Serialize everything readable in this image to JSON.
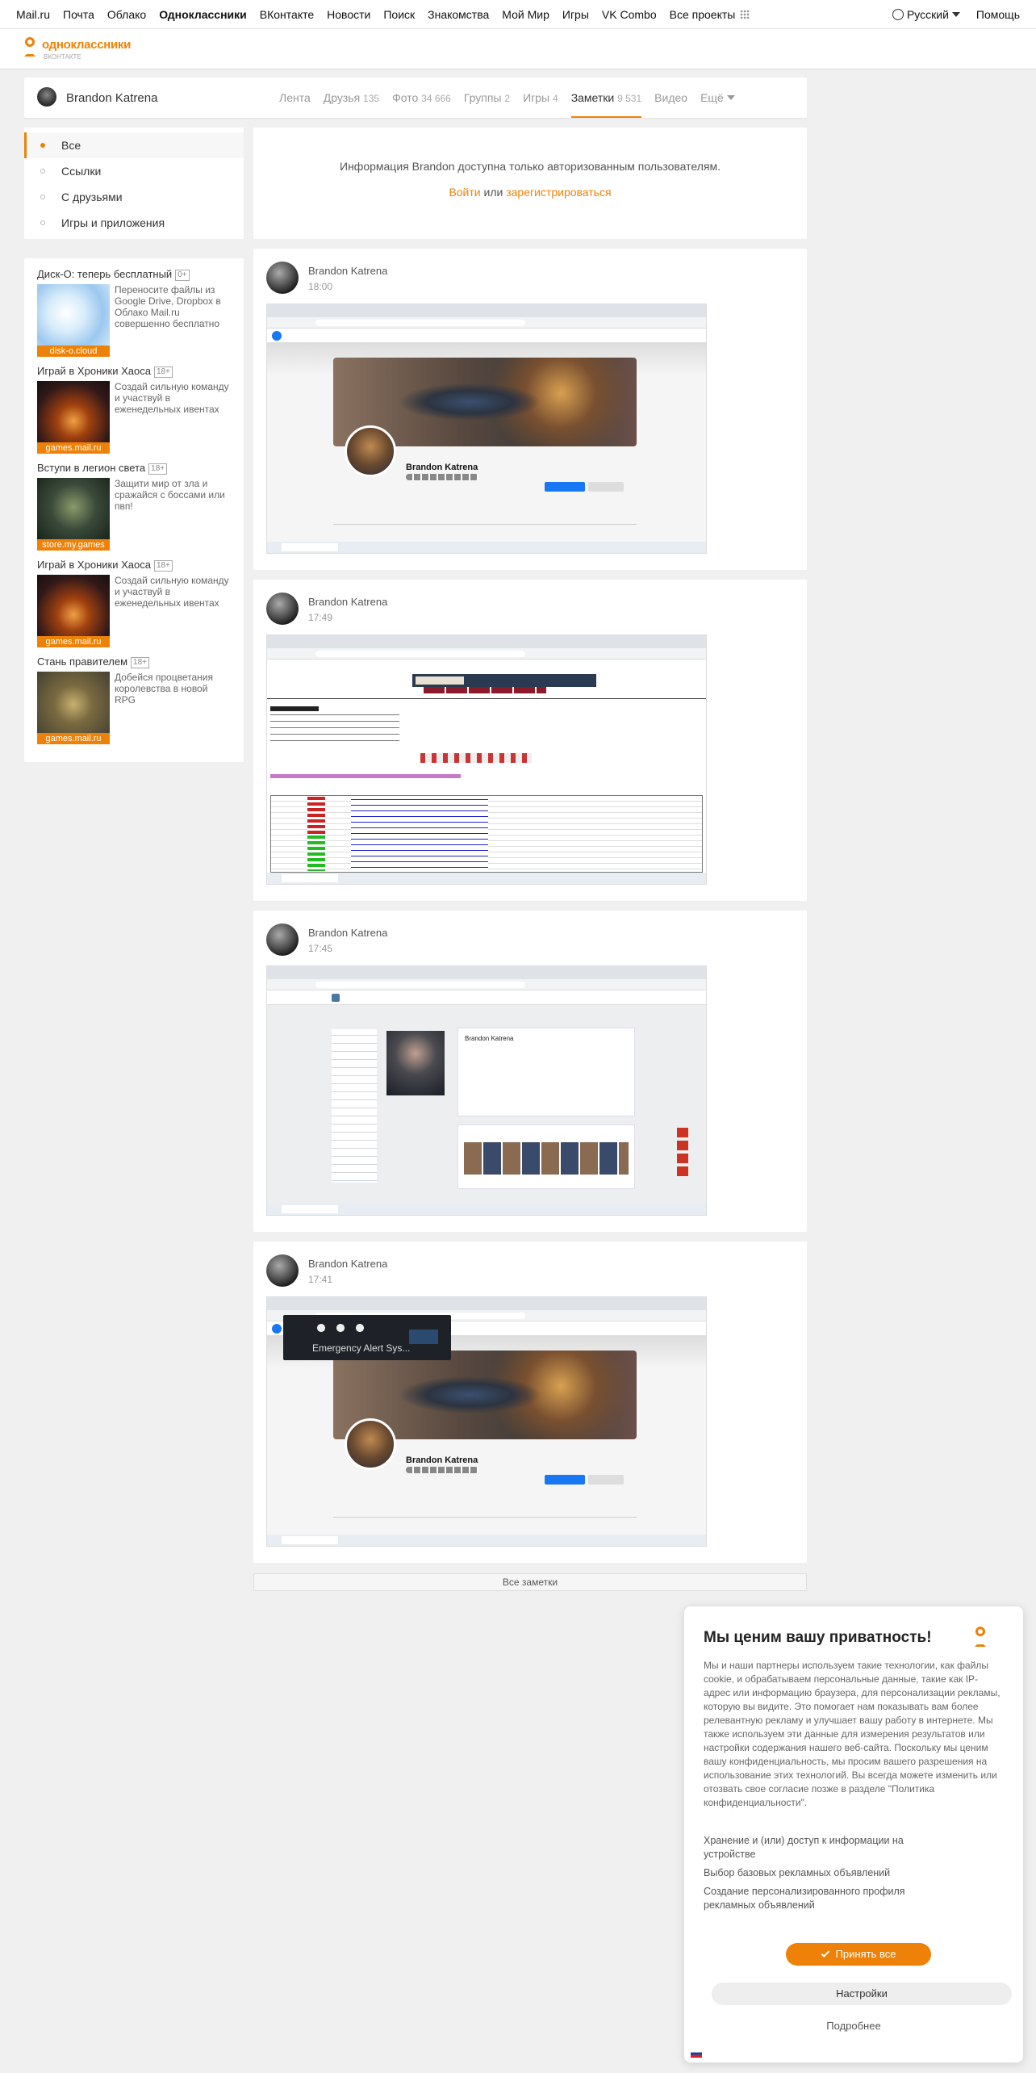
{
  "topbar": {
    "links": [
      "Mail.ru",
      "Почта",
      "Облако",
      "Одноклассники",
      "ВКонтакте",
      "Новости",
      "Поиск",
      "Знакомства",
      "Мой Мир",
      "Игры",
      "VK Combo",
      "Все проекты"
    ],
    "language": "Русский",
    "help": "Помощь"
  },
  "logo": {
    "text": "одноклассники",
    "sub": "ВКОНТАКТЕ"
  },
  "profile": {
    "name": "Brandon Katrena",
    "tabs": [
      {
        "label": "Лента",
        "count": ""
      },
      {
        "label": "Друзья",
        "count": "135"
      },
      {
        "label": "Фото",
        "count": "34 666"
      },
      {
        "label": "Группы",
        "count": "2"
      },
      {
        "label": "Игры",
        "count": "4"
      },
      {
        "label": "Заметки",
        "count": "9 531"
      },
      {
        "label": "Видео",
        "count": ""
      },
      {
        "label": "Ещё",
        "count": ""
      }
    ]
  },
  "side_menu": [
    "Все",
    "Ссылки",
    "С друзьями",
    "Игры и приложения"
  ],
  "ads": [
    {
      "title": "Диск-О: теперь бесплатный",
      "age": "0+",
      "text": "Переносите файлы из Google Drive, Dropbox в Облако Mail.ru совершенно бесплатно",
      "label": "disk-o.cloud"
    },
    {
      "title": "Играй в Хроники Хаоса",
      "age": "18+",
      "text": "Создай сильную команду и участвуй в еженедельных ивентах",
      "label": "games.mail.ru"
    },
    {
      "title": "Вступи в легион света",
      "age": "18+",
      "text": "Защити мир от зла и сражайся с боссами или пвп!",
      "label": "store.my.games"
    },
    {
      "title": "Играй в Хроники Хаоса",
      "age": "18+",
      "text": "Создай сильную команду и участвуй в еженедельных ивентах",
      "label": "games.mail.ru"
    },
    {
      "title": "Стань правителем",
      "age": "18+",
      "text": "Добейся процветания королевства в новой RPG",
      "label": "games.mail.ru"
    }
  ],
  "info": {
    "text": "Информация Brandon доступна только авторизованным пользователям.",
    "login": "Войти",
    "or": "или",
    "register": "зарегистрироваться"
  },
  "posts": [
    {
      "author": "Brandon Katrena",
      "time": "18:00",
      "shot_name": "Brandon Katrena"
    },
    {
      "author": "Brandon Katrena",
      "time": "17:49",
      "shot_name": "Copyright"
    },
    {
      "author": "Brandon Katrena",
      "time": "17:45",
      "shot_name": "Brandon Katrena"
    },
    {
      "author": "Brandon Katrena",
      "time": "17:41",
      "shot_name": "Brandon Katrena",
      "notification": "Emergency Alert Sys..."
    }
  ],
  "all_notes": "Все заметки",
  "privacy": {
    "title": "Мы ценим вашу приватность!",
    "text": "Мы и наши партнеры используем такие технологии, как файлы cookie, и обрабатываем персональные данные, такие как IP-адрес или информацию браузера, для персонализации рекламы, которую вы видите. Это помогает нам показывать вам более релевантную рекламу и улучшает вашу работу в интернете. Мы также используем эти данные для измерения результатов или настройки содержания нашего веб-сайта. Поскольку мы ценим вашу конфиденциальность, мы просим вашего разрешения на использование этих технологий. Вы всегда можете изменить или отозвать свое согласие позже в разделе \"Политика конфиденциальности\".",
    "items": [
      "Хранение и (или) доступ к информации на устройстве",
      "Выбор базовых рекламных объявлений",
      "Создание персонализированного профиля рекламных объявлений"
    ],
    "accept": "Принять все",
    "settings": "Настройки",
    "more": "Подробнее"
  },
  "colors": {
    "accent": "#ee8208",
    "background": "#f0f0f0"
  }
}
